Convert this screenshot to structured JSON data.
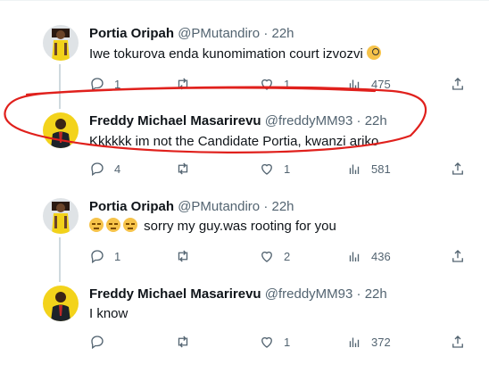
{
  "tweets": [
    {
      "name": "Portia Oripah",
      "handle": "@PMutandiro",
      "dot": "·",
      "time": "22h",
      "text": "Iwe tokurova enda kunomimation court izvozvi",
      "emoji": "monocle-face",
      "avatar": "woman-yellow-dress-avatar",
      "actions": {
        "reply": "1",
        "retweet": "",
        "like": "1",
        "views": "475"
      }
    },
    {
      "name": "Freddy Michael Masarirevu",
      "handle": "@freddyMM93",
      "dot": "·",
      "time": "22h",
      "text": "Kkkkkk im not the Candidate Portia, kwanzi ariko",
      "avatar": "man-suit-yellow-avatar",
      "actions": {
        "reply": "4",
        "retweet": "",
        "like": "1",
        "views": "581"
      }
    },
    {
      "name": "Portia Oripah",
      "handle": "@PMutandiro",
      "dot": "·",
      "time": "22h",
      "text": "sorry my guy.was rooting for you",
      "emoji": "pensive-face",
      "avatar": "woman-yellow-dress-avatar",
      "actions": {
        "reply": "1",
        "retweet": "",
        "like": "2",
        "views": "436"
      }
    },
    {
      "name": "Freddy Michael Masarirevu",
      "handle": "@freddyMM93",
      "dot": "·",
      "time": "22h",
      "text": "I know",
      "avatar": "man-suit-yellow-avatar",
      "actions": {
        "reply": "",
        "retweet": "",
        "like": "1",
        "views": "372"
      }
    }
  ],
  "colors": {
    "text_primary": "#0f1419",
    "text_secondary": "#536471",
    "thread_line": "#cfd9de",
    "annotation_red": "#e0201c",
    "avatar_yellow": "#f3d31b"
  }
}
